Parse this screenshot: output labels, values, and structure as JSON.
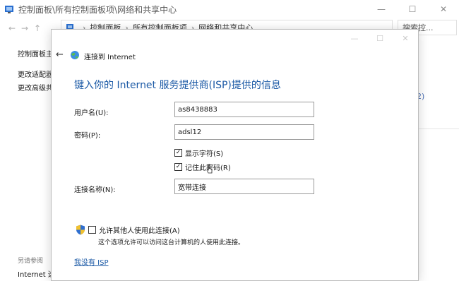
{
  "background_window": {
    "title": "控制面板\\所有控制面板项\\网络和共享中心",
    "controls": {
      "minimize": "—",
      "maximize": "☐",
      "close": "✕"
    },
    "nav": {
      "back": "←",
      "forward": "→",
      "up": "↑"
    },
    "address": [
      "控制面板",
      "所有控制面板项",
      "网络和共享中心"
    ],
    "search_placeholder": "搜索控...",
    "sidebar": {
      "items": [
        "控制面板主",
        "更改适配器",
        "更改高级共"
      ],
      "see_also": "另请参阅",
      "internet": "Internet 选"
    },
    "right_fragment": "2)"
  },
  "dialog": {
    "controls": {
      "minimize": "—",
      "maximize": "☐",
      "close": "✕"
    },
    "back": "←",
    "header_title": "连接到 Internet",
    "heading": "键入你的 Internet 服务提供商(ISP)提供的信息",
    "fields": {
      "username": {
        "label": "用户名(U):",
        "value": "as8438883"
      },
      "password": {
        "label": "密码(P):",
        "value": "adsl12"
      },
      "connection_name": {
        "label": "连接名称(N):",
        "value": "宽带连接"
      }
    },
    "checkboxes": {
      "show_chars": {
        "label": "显示字符(S)",
        "checked": true,
        "mark": "✓"
      },
      "remember_password": {
        "label": "记住此密码(R)",
        "checked": true,
        "mark": "✓"
      }
    },
    "allow_others": {
      "label": "允许其他人使用此连接(A)",
      "checked": false
    },
    "allow_description": "这个选项允许可以访问这台计算机的人使用此连接。",
    "no_isp_link": "我没有 ISP"
  },
  "colors": {
    "accent": "#1c5aa6",
    "input_border": "#9a9a9a",
    "shield_blue": "#2f6fd0",
    "shield_yellow": "#f2c12e"
  }
}
